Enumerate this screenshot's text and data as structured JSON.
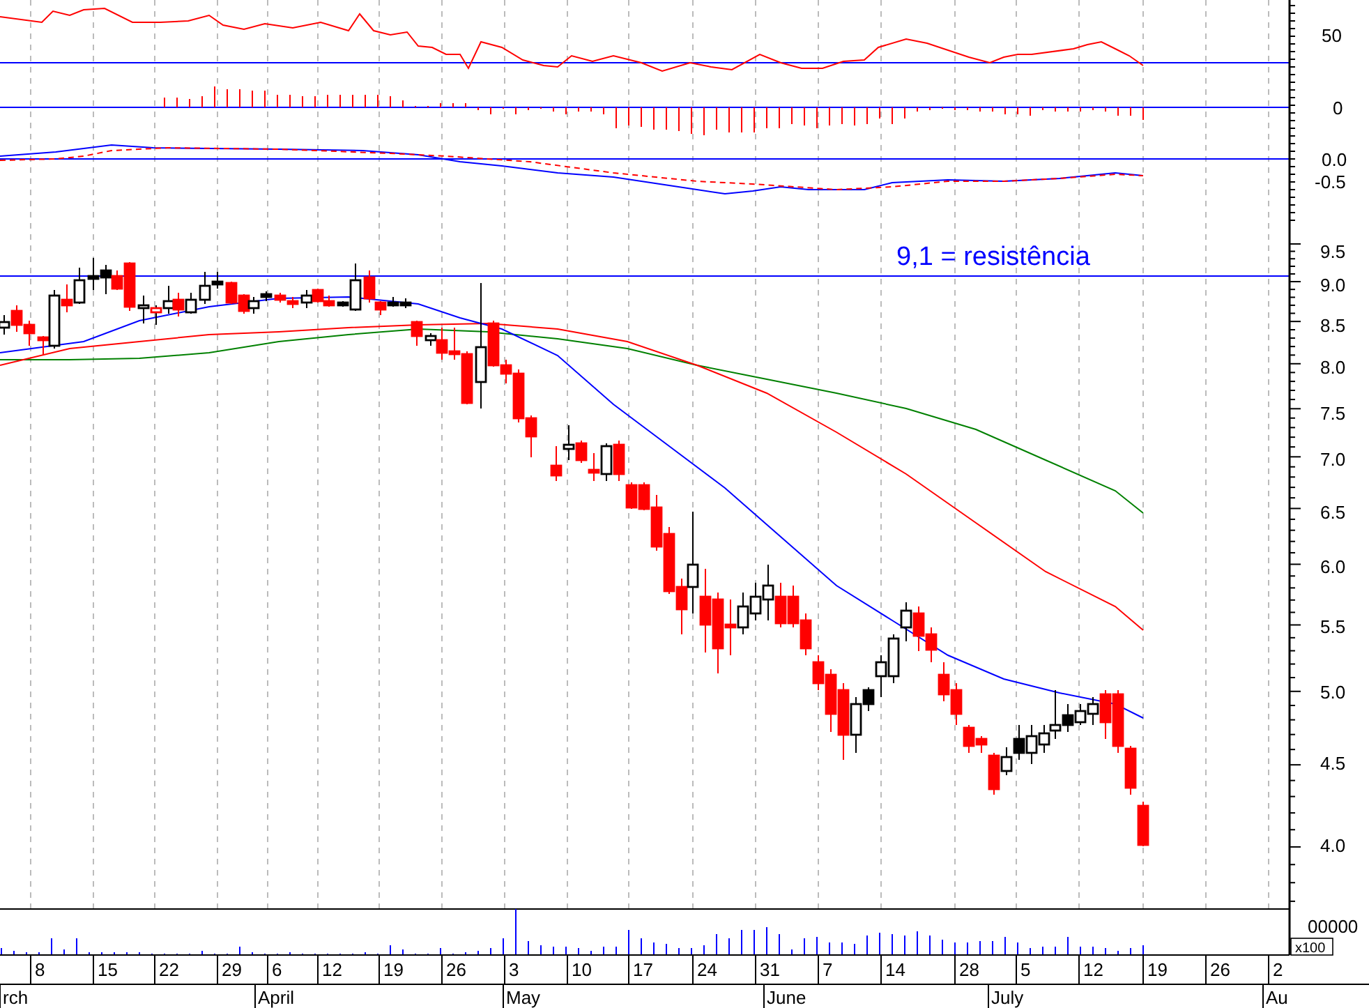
{
  "indicator_panels": [
    {
      "kind": "oscillator",
      "ticks": [
        "50"
      ]
    },
    {
      "kind": "histogram",
      "ticks": [
        "0"
      ]
    },
    {
      "kind": "macd",
      "ticks": [
        "0.0",
        "-0.5"
      ]
    }
  ],
  "price_panel": {
    "annotation": "9,1 = resistência",
    "ticks": [
      "9.5",
      "9.0",
      "8.5",
      "8.0",
      "7.5",
      "7.0",
      "6.5",
      "6.0",
      "5.5",
      "5.0",
      "4.5",
      "4.0"
    ]
  },
  "volume_panel": {
    "tick": "00000",
    "multiplier": "x100"
  },
  "date_axis": {
    "days": [
      "8",
      "15",
      "22",
      "29",
      "6",
      "12",
      "19",
      "26",
      "3",
      "10",
      "17",
      "24",
      "31",
      "7",
      "14",
      "28",
      "5",
      "12",
      "19",
      "26",
      "2"
    ],
    "months": [
      "rch",
      "April",
      "May",
      "June",
      "July",
      "Au"
    ]
  }
}
